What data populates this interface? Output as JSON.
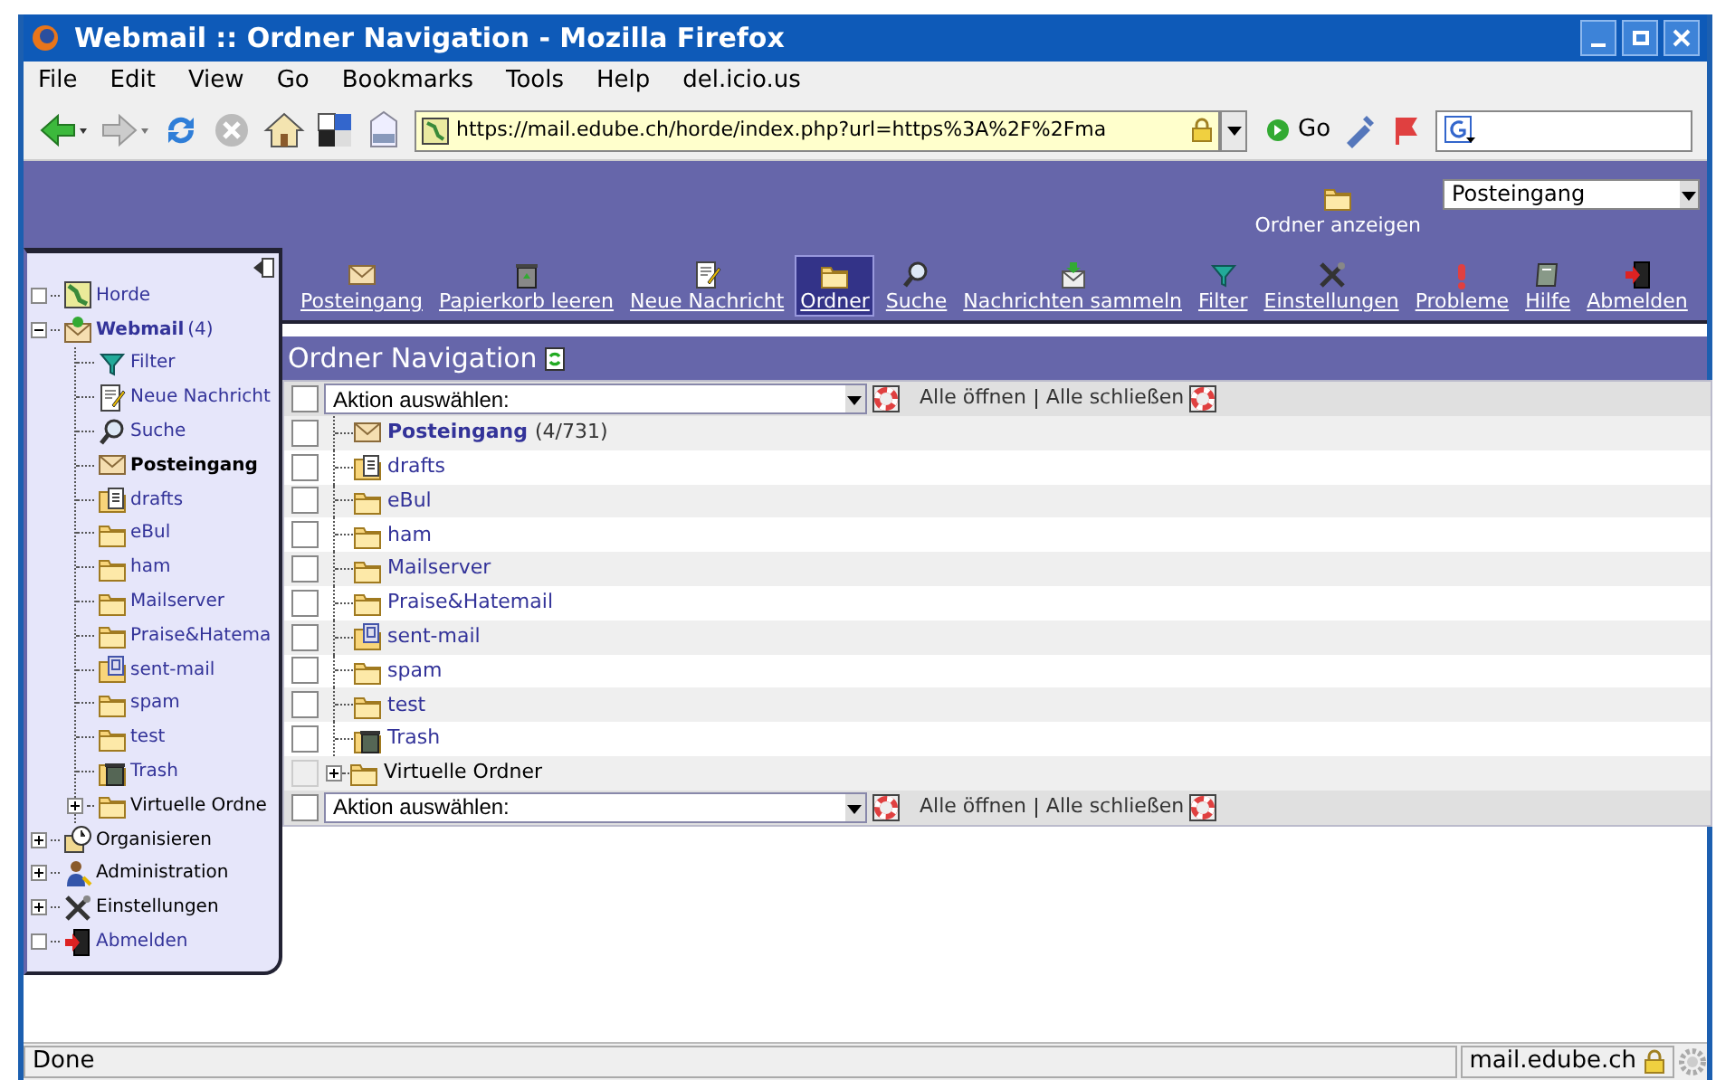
{
  "window": {
    "title": "Webmail :: Ordner Navigation - Mozilla Firefox"
  },
  "menu": [
    "File",
    "Edit",
    "View",
    "Go",
    "Bookmarks",
    "Tools",
    "Help",
    "del.icio.us"
  ],
  "address_bar": {
    "value": "https://mail.edube.ch/horde/index.php?url=https%3A%2F%2Fma"
  },
  "go_button": "Go",
  "header": {
    "folder_link": "Ordner anzeigen",
    "folder_select": "Posteingang"
  },
  "toolbar": [
    {
      "label": "Posteingang",
      "kind": "inbox",
      "selected": false
    },
    {
      "label": "Papierkorb leeren",
      "kind": "emptytrash",
      "selected": false
    },
    {
      "label": "Neue Nachricht",
      "kind": "compose",
      "selected": false
    },
    {
      "label": "Ordner",
      "kind": "folder",
      "selected": true
    },
    {
      "label": "Suche",
      "kind": "search",
      "selected": false
    },
    {
      "label": "Nachrichten sammeln",
      "kind": "fetch",
      "selected": false
    },
    {
      "label": "Filter",
      "kind": "filter",
      "selected": false
    },
    {
      "label": "Einstellungen",
      "kind": "settings",
      "selected": false
    },
    {
      "label": "Probleme",
      "kind": "problem",
      "selected": false
    },
    {
      "label": "Hilfe",
      "kind": "help",
      "selected": false
    },
    {
      "label": "Abmelden",
      "kind": "logout",
      "selected": false
    }
  ],
  "sidebar": {
    "items": [
      {
        "label": "Horde",
        "kind": "horde",
        "link": true,
        "unread": false
      },
      {
        "label": "Webmail",
        "count": "(4)",
        "kind": "webmail",
        "expanded": true,
        "link": true,
        "unread": true,
        "children": [
          {
            "label": "Filter",
            "kind": "filter",
            "link": true,
            "unread": false
          },
          {
            "label": "Neue Nachricht",
            "kind": "compose",
            "link": true,
            "unread": false
          },
          {
            "label": "Suche",
            "kind": "search",
            "link": true,
            "unread": false
          },
          {
            "label": "Posteingang",
            "kind": "inbox",
            "link": false,
            "unread": true
          },
          {
            "label": "drafts",
            "kind": "drafts",
            "link": true,
            "unread": false
          },
          {
            "label": "eBul",
            "kind": "folder",
            "link": true,
            "unread": false
          },
          {
            "label": "ham",
            "kind": "folder",
            "link": true,
            "unread": false
          },
          {
            "label": "Mailserver",
            "kind": "folder",
            "link": true,
            "unread": false
          },
          {
            "label": "Praise&Hatema",
            "kind": "folder",
            "link": true,
            "unread": false
          },
          {
            "label": "sent-mail",
            "kind": "sent",
            "link": true,
            "unread": false
          },
          {
            "label": "spam",
            "kind": "folder",
            "link": true,
            "unread": false
          },
          {
            "label": "test",
            "kind": "folder",
            "link": true,
            "unread": false
          },
          {
            "label": "Trash",
            "kind": "trash",
            "link": true,
            "unread": false
          },
          {
            "label": "Virtuelle Ordne",
            "kind": "folder",
            "expanded": false,
            "link": false,
            "unread": false
          }
        ]
      },
      {
        "label": "Organisieren",
        "kind": "organize",
        "expanded": false,
        "link": false,
        "unread": false
      },
      {
        "label": "Administration",
        "kind": "admin",
        "expanded": false,
        "link": false,
        "unread": false
      },
      {
        "label": "Einstellungen",
        "kind": "settings",
        "expanded": false,
        "link": false,
        "unread": false
      },
      {
        "label": "Abmelden",
        "kind": "logout",
        "link": true,
        "unread": false
      }
    ]
  },
  "page_title": "Ordner Navigation",
  "action_bars": [
    {
      "checked": false,
      "select": "Aktion auswählen:",
      "open_all": "Alle öffnen",
      "close_all": "Alle schließen"
    },
    {
      "checked": false,
      "select": "Aktion auswählen:",
      "open_all": "Alle öffnen",
      "close_all": "Alle schließen"
    }
  ],
  "folders": [
    {
      "label": "Posteingang",
      "count": "(4/731)",
      "kind": "inbox",
      "unread": true,
      "link": true,
      "checked": false,
      "disabled": false
    },
    {
      "label": "drafts",
      "kind": "drafts",
      "unread": false,
      "link": true,
      "checked": false,
      "disabled": false
    },
    {
      "label": "eBul",
      "kind": "folder",
      "unread": false,
      "link": true,
      "checked": false,
      "disabled": false
    },
    {
      "label": "ham",
      "kind": "folder",
      "unread": false,
      "link": true,
      "checked": false,
      "disabled": false
    },
    {
      "label": "Mailserver",
      "kind": "folder",
      "unread": false,
      "link": true,
      "checked": false,
      "disabled": false
    },
    {
      "label": "Praise&Hatemail",
      "kind": "folder",
      "unread": false,
      "link": true,
      "checked": false,
      "disabled": false
    },
    {
      "label": "sent-mail",
      "kind": "sent",
      "unread": false,
      "link": true,
      "checked": false,
      "disabled": false
    },
    {
      "label": "spam",
      "kind": "folder",
      "unread": false,
      "link": true,
      "checked": false,
      "disabled": false
    },
    {
      "label": "test",
      "kind": "folder",
      "unread": false,
      "link": true,
      "checked": false,
      "disabled": false
    },
    {
      "label": "Trash",
      "kind": "trash",
      "unread": false,
      "link": true,
      "checked": false,
      "disabled": false
    },
    {
      "label": "Virtuelle Ordner",
      "kind": "folder",
      "unread": false,
      "link": false,
      "checked": false,
      "disabled": true,
      "expanded": false
    }
  ],
  "status_bar": {
    "text": "Done",
    "host": "mail.edube.ch"
  }
}
